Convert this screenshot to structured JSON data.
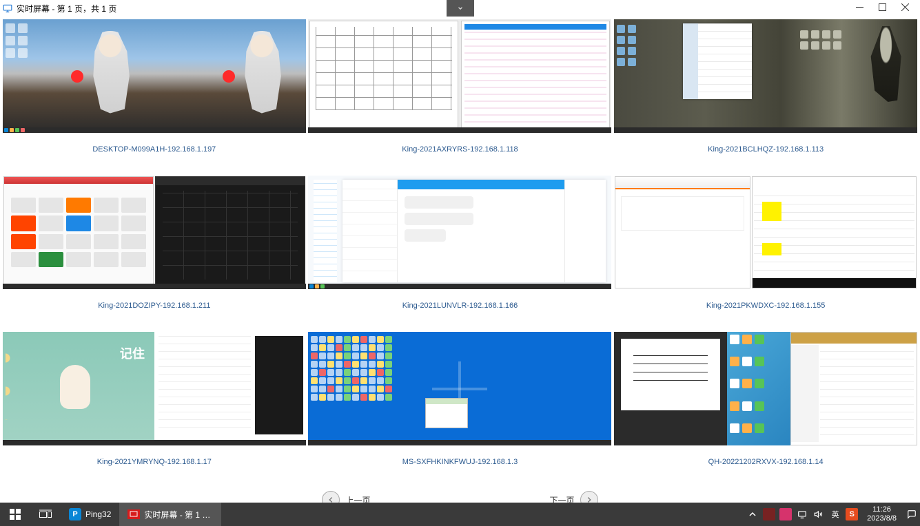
{
  "title": "实时屏幕 - 第 1 页，共 1 页",
  "collapse_chevron": "∨",
  "cells": [
    {
      "label": "DESKTOP-M099A1H-192.168.1.197"
    },
    {
      "label": "King-2021AXRYRS-192.168.1.118"
    },
    {
      "label": "King-2021BCLHQZ-192.168.1.113"
    },
    {
      "label": "King-2021DOZIPY-192.168.1.211"
    },
    {
      "label": "King-2021LUNVLR-192.168.1.166"
    },
    {
      "label": "King-2021PKWDXC-192.168.1.155"
    },
    {
      "label": "King-2021YMRYNQ-192.168.1.17"
    },
    {
      "label": "MS-SXFHKINKFWUJ-192.168.1.3"
    },
    {
      "label": "QH-20221202RXVX-192.168.1.14"
    }
  ],
  "scene7": {
    "banner_text": "记住"
  },
  "pager": {
    "prev": "上一页",
    "next": "下一页"
  },
  "taskbar": {
    "apps": [
      {
        "name": "Ping32",
        "icon": "P"
      },
      {
        "name": "实时屏幕 - 第 1 页..."
      }
    ],
    "tray": {
      "ime": "英",
      "time": "11:26",
      "date": "2023/8/8"
    }
  }
}
